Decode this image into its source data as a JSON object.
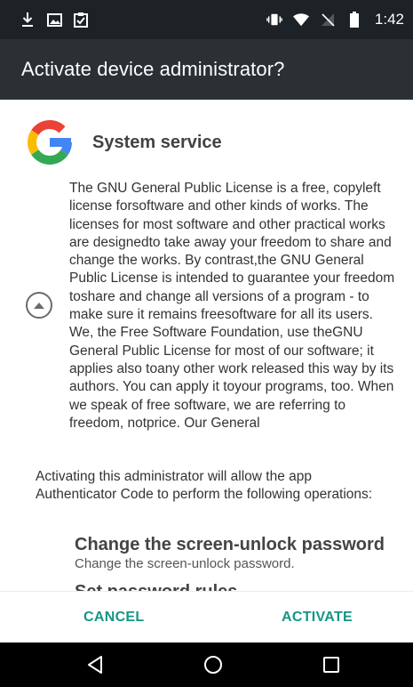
{
  "status_bar": {
    "time": "1:42",
    "left_icons": [
      "download-icon",
      "image-icon",
      "clipboard-check-icon"
    ],
    "right_icons": [
      "vibrate-icon",
      "wifi-icon",
      "no-sim-icon",
      "battery-icon"
    ]
  },
  "dialog": {
    "title": "Activate device administrator?"
  },
  "app": {
    "name": "System service",
    "icon": "google-g-icon",
    "description": "The GNU General Public License is a free, copyleft license forsoftware and other kinds of works.  The licenses for most software and other practical works are designedto take away your freedom to share and change the works.  By contrast,the GNU General Public License is intended to guarantee your freedom toshare and change all versions of a program - to make sure it remains freesoftware for all its users.  We, the Free Software Foundation, use theGNU General Public License for most of our software; it applies also toany other work released this way by its authors.  You can apply it toyour programs, too.  When we speak of free software, we are referring to freedom, notprice.  Our General"
  },
  "activation": {
    "text": "Activating this administrator will allow the app Authenticator Code to perform the following operations:",
    "policies": [
      {
        "title": "Change the screen-unlock password",
        "description": "Change the screen-unlock password."
      },
      {
        "title": "Set password rules"
      }
    ]
  },
  "buttons": {
    "cancel": "CANCEL",
    "activate": "ACTIVATE"
  },
  "nav_bar": {
    "icons": [
      "back-icon",
      "home-icon",
      "recents-icon"
    ]
  },
  "colors": {
    "status_bar": "#1d2226",
    "app_bar": "#2b3034",
    "accent": "#159584"
  }
}
